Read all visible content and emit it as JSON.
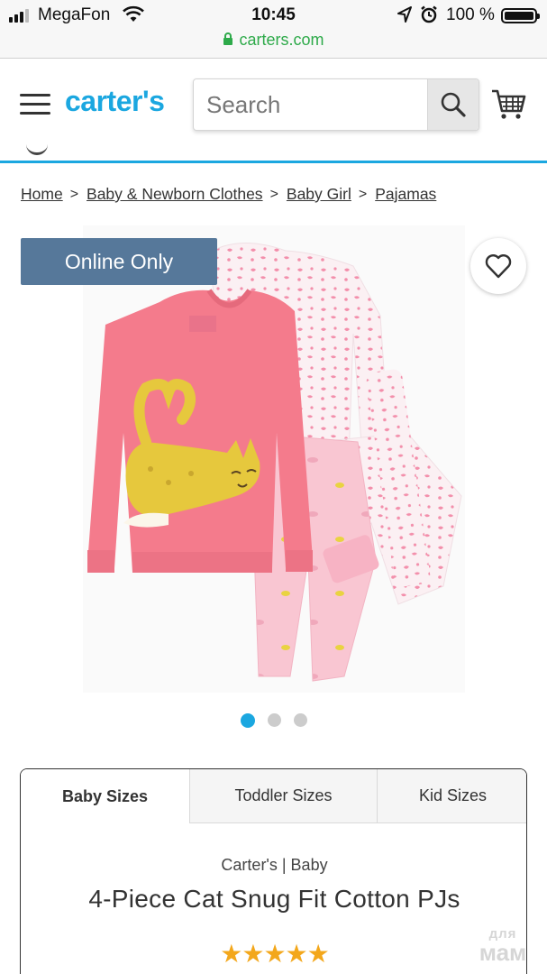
{
  "status_bar": {
    "carrier": "MegaFon",
    "time": "10:45",
    "battery": "100 %"
  },
  "browser": {
    "url": "carters.com"
  },
  "header": {
    "logo": "carter's",
    "search_placeholder": "Search"
  },
  "breadcrumb": [
    "Home",
    "Baby & Newborn Clothes",
    "Baby Girl",
    "Pajamas"
  ],
  "product": {
    "badge": "Online Only",
    "carousel_count": 3,
    "carousel_active": 1
  },
  "size_tabs": [
    "Baby Sizes",
    "Toddler Sizes",
    "Kid Sizes"
  ],
  "active_tab": "Baby Sizes",
  "details": {
    "brand_line": "Carter's | Baby",
    "title": "4-Piece Cat Snug Fit Cotton PJs",
    "rating_stars": "★★★★★",
    "rating": 5
  },
  "watermark": {
    "line1": "для",
    "line2": "мам"
  },
  "colors": {
    "brand_blue": "#1ba7e0",
    "badge": "#56789a",
    "star": "#f3a71b",
    "url_green": "#2eaa4a"
  }
}
